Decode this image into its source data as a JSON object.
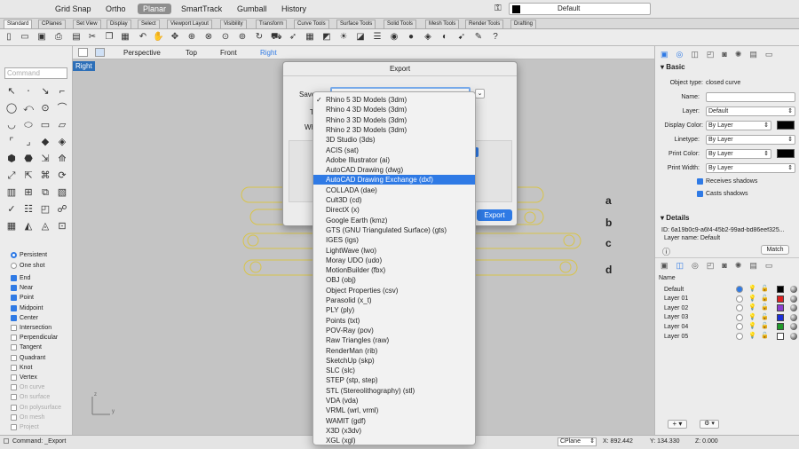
{
  "topbar": {
    "grid_snap": "Grid Snap",
    "ortho": "Ortho",
    "planar": "Planar",
    "smarttrack": "SmartTrack",
    "gumball": "Gumball",
    "history": "History",
    "layer": "Default"
  },
  "tabs": [
    "Standard",
    "CPlanes",
    "Set View",
    "Display",
    "Select",
    "Viewport Layout",
    "Visibility",
    "Transform",
    "Curve Tools",
    "Surface Tools",
    "Solid Tools",
    "Mesh Tools",
    "Render Tools",
    "Drafting"
  ],
  "left": {
    "command_placeholder": "Command",
    "persistent": "Persistent",
    "one_shot": "One shot",
    "snaps": [
      {
        "label": "End",
        "on": true
      },
      {
        "label": "Near",
        "on": true
      },
      {
        "label": "Point",
        "on": true
      },
      {
        "label": "Midpoint",
        "on": true
      },
      {
        "label": "Center",
        "on": true
      },
      {
        "label": "Intersection",
        "on": false
      },
      {
        "label": "Perpendicular",
        "on": false
      },
      {
        "label": "Tangent",
        "on": false
      },
      {
        "label": "Quadrant",
        "on": false
      },
      {
        "label": "Knot",
        "on": false
      },
      {
        "label": "Vertex",
        "on": false
      },
      {
        "label": "On curve",
        "on": false
      },
      {
        "label": "On surface",
        "on": false
      },
      {
        "label": "On polysurface",
        "on": false
      },
      {
        "label": "On mesh",
        "on": false
      },
      {
        "label": "Project",
        "on": false
      }
    ]
  },
  "viewtabs": {
    "perspective": "Perspective",
    "top": "Top",
    "front": "Front",
    "right": "Right"
  },
  "viewport": {
    "label": "Right",
    "curve_labels": [
      "a",
      "b",
      "c",
      "d"
    ],
    "axis_z": "z",
    "axis_y": "y"
  },
  "dialog": {
    "title": "Export",
    "save_as": "Save",
    "tags": "T",
    "where": "Wh",
    "export": "Export"
  },
  "formats": [
    "Rhino 5 3D Models (3dm)",
    "Rhino 4 3D Models (3dm)",
    "Rhino 3 3D Models (3dm)",
    "Rhino 2 3D Models (3dm)",
    "3D Studio (3ds)",
    "ACIS (sat)",
    "Adobe Illustrator (ai)",
    "AutoCAD Drawing (dwg)",
    "AutoCAD Drawing Exchange (dxf)",
    "COLLADA (dae)",
    "Cult3D (cd)",
    "DirectX (x)",
    "Google Earth (kmz)",
    "GTS (GNU Triangulated Surface) (gts)",
    "IGES (igs)",
    "LightWave (lwo)",
    "Moray UDO (udo)",
    "MotionBuilder (fbx)",
    "OBJ (obj)",
    "Object Properties (csv)",
    "Parasolid (x_t)",
    "PLY (ply)",
    "Points (txt)",
    "POV-Ray (pov)",
    "Raw Triangles (raw)",
    "RenderMan (rib)",
    "SketchUp (skp)",
    "SLC (slc)",
    "STEP (stp, step)",
    "STL (Stereolithography) (stl)",
    "VDA (vda)",
    "VRML (wrl, vrml)",
    "WAMIT (gdf)",
    "X3D (x3dv)",
    "XGL (xgl)"
  ],
  "formats_checked_index": 0,
  "formats_highlight_index": 8,
  "properties": {
    "basic": "Basic",
    "object_type_label": "Object type:",
    "object_type": "closed curve",
    "name_label": "Name:",
    "layer_label": "Layer:",
    "layer": "Default",
    "display_color_label": "Display Color:",
    "display_color": "By Layer",
    "linetype_label": "Linetype:",
    "linetype": "By Layer",
    "print_color_label": "Print Color:",
    "print_color": "By Layer",
    "print_width_label": "Print Width:",
    "print_width": "By Layer",
    "receives_shadows": "Receives shadows",
    "casts_shadows": "Casts shadows",
    "details": "Details",
    "id": "ID: 6a19b0c9-a6f4-45b2-99ad-bd86eef325...",
    "layer_name": "Layer name: Default",
    "match": "Match"
  },
  "layers": {
    "name_header": "Name",
    "rows": [
      {
        "name": "Default",
        "color": "#000000",
        "current": true
      },
      {
        "name": "Layer 01",
        "color": "#e02020",
        "current": false
      },
      {
        "name": "Layer 02",
        "color": "#8a3fd1",
        "current": false
      },
      {
        "name": "Layer 03",
        "color": "#1c2fd8",
        "current": false
      },
      {
        "name": "Layer 04",
        "color": "#1f9a2a",
        "current": false
      },
      {
        "name": "Layer 05",
        "color": "#ffffff",
        "current": false
      }
    ]
  },
  "status": {
    "command": "Command: _Export",
    "cplane": "CPlane",
    "x": "X: 892.442",
    "y": "Y: 134.330",
    "z": "Z: 0.000"
  },
  "colors": {
    "accent": "#2f7ae5",
    "curve": "#d8c44a"
  }
}
